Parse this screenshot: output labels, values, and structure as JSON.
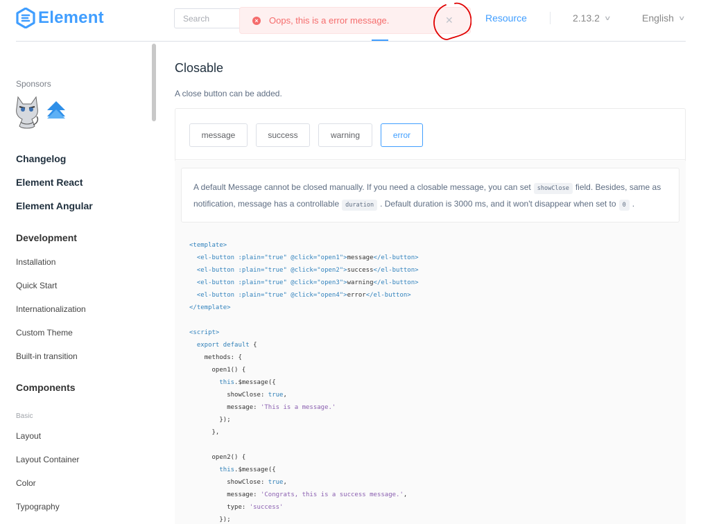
{
  "header": {
    "brand": "Element",
    "search_placeholder": "Search",
    "nav_resource": "Resource",
    "version": "2.13.2",
    "language": "English"
  },
  "message": {
    "icon": "error-circle-icon",
    "text": "Oops, this is a error message.",
    "close_icon": "close-icon"
  },
  "sidebar": {
    "sponsors_label": "Sponsors",
    "top_links": [
      "Changelog",
      "Element React",
      "Element Angular"
    ],
    "development_label": "Development",
    "development_items": [
      "Installation",
      "Quick Start",
      "Internationalization",
      "Custom Theme",
      "Built-in transition"
    ],
    "components_label": "Components",
    "basic_label": "Basic",
    "basic_items": [
      "Layout",
      "Layout Container",
      "Color",
      "Typography"
    ]
  },
  "main": {
    "title": "Closable",
    "description": "A close button can be added.",
    "buttons": [
      "message",
      "success",
      "warning",
      "error"
    ],
    "note_part1": "A default Message cannot be closed manually. If you need a closable message, you can set",
    "note_code1": "showClose",
    "note_part2": "field. Besides, same as notification, message has a controllable",
    "note_code2": "duration",
    "note_part3": ". Default duration is 3000 ms, and it won't disappear when set to",
    "note_code3": "0",
    "note_part4": "."
  },
  "code": {
    "l1": "<template>",
    "l2a": "<el-button :plain=\"true\" @click=\"open1\">",
    "l2b": "message",
    "l2c": "</el-button>",
    "l3a": "<el-button :plain=\"true\" @click=\"open2\">",
    "l3b": "success",
    "l3c": "</el-button>",
    "l4a": "<el-button :plain=\"true\" @click=\"open3\">",
    "l4b": "warning",
    "l4c": "</el-button>",
    "l5a": "<el-button :plain=\"true\" @click=\"open4\">",
    "l5b": "error",
    "l5c": "</el-button>",
    "l6": "</template>",
    "l8": "<script>",
    "l9a": "export default",
    "l9b": " {",
    "l10": "methods: {",
    "l11": "open1() {",
    "l12a": "this",
    "l12b": ".$message({",
    "l13a": "showClose: ",
    "l13b": "true",
    "l13c": ",",
    "l14a": "message: ",
    "l14b": "'This is a message.'",
    "l15": "});",
    "l16": "},",
    "l18": "open2() {",
    "l19a": "this",
    "l19b": ".$message({",
    "l20a": "showClose: ",
    "l20b": "true",
    "l20c": ",",
    "l21a": "message: ",
    "l21b": "'Congrats, this is a success message.'",
    "l21c": ",",
    "l22a": "type: ",
    "l22b": "'success'",
    "l23": "});"
  },
  "colors": {
    "brand": "#409eff",
    "error": "#f56c6c",
    "error_bg": "#fef0f0",
    "annotation": "#e00000"
  }
}
